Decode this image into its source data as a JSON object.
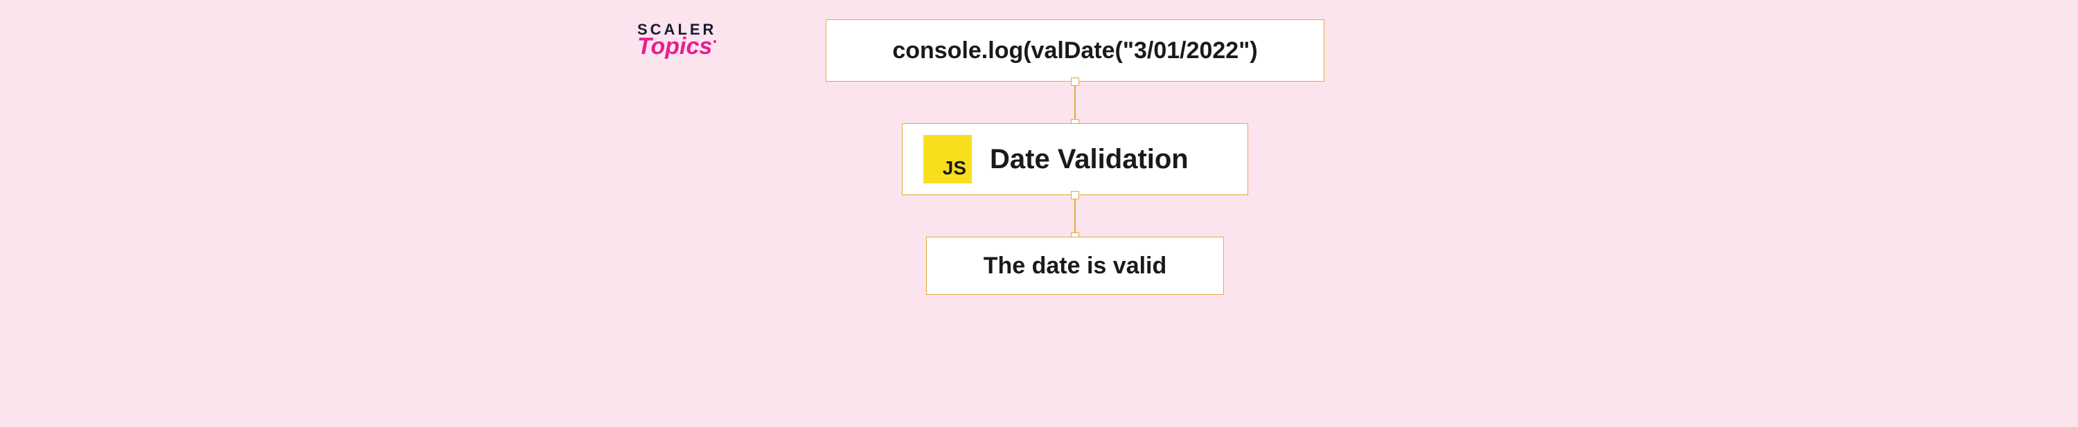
{
  "logo": {
    "line1": "SCALER",
    "line2": "Topics"
  },
  "diagram": {
    "top_box": "console.log(valDate(\"3/01/2022\")",
    "middle_box": {
      "badge": "JS",
      "label": "Date Validation"
    },
    "bottom_box": "The date is valid"
  }
}
